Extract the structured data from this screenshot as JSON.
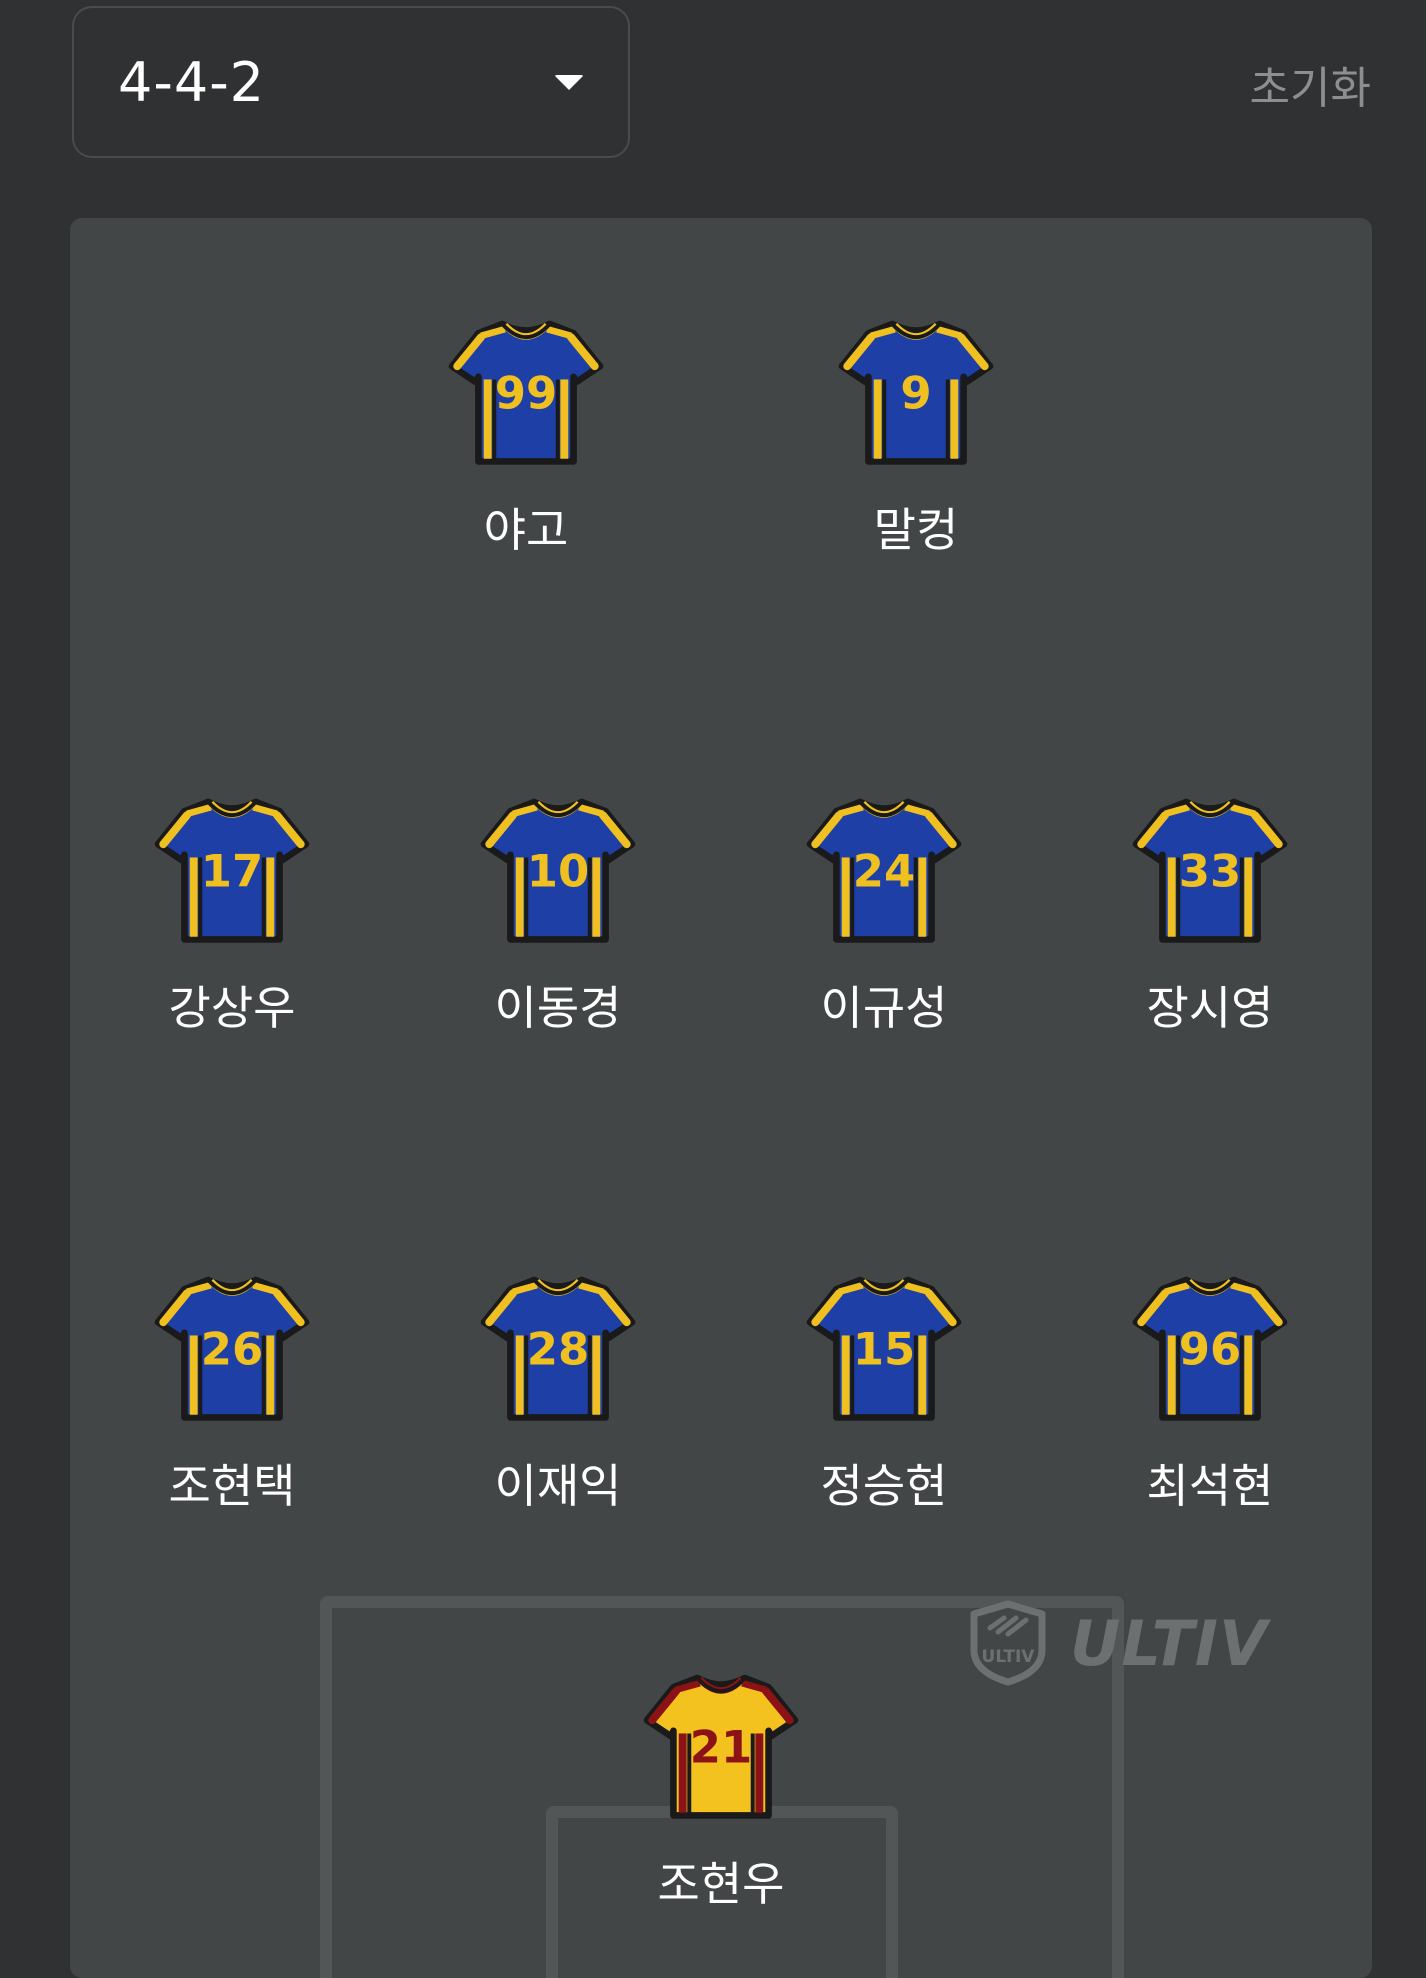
{
  "formation": {
    "selected": "4-4-2"
  },
  "reset_label": "초기화",
  "colors": {
    "field_jersey": "#1d3fa6",
    "field_trim": "#f0c020",
    "field_number": "#f0c020",
    "keeper_jersey": "#f4c21f",
    "keeper_trim": "#8b1316",
    "keeper_number": "#8b1316"
  },
  "players": [
    {
      "number": "99",
      "name": "야고",
      "role": "field"
    },
    {
      "number": "9",
      "name": "말컹",
      "role": "field"
    },
    {
      "number": "17",
      "name": "강상우",
      "role": "field"
    },
    {
      "number": "10",
      "name": "이동경",
      "role": "field"
    },
    {
      "number": "24",
      "name": "이규성",
      "role": "field"
    },
    {
      "number": "33",
      "name": "장시영",
      "role": "field"
    },
    {
      "number": "26",
      "name": "조현택",
      "role": "field"
    },
    {
      "number": "28",
      "name": "이재익",
      "role": "field"
    },
    {
      "number": "15",
      "name": "정승현",
      "role": "field"
    },
    {
      "number": "96",
      "name": "최석현",
      "role": "field"
    },
    {
      "number": "21",
      "name": "조현우",
      "role": "keeper"
    }
  ],
  "watermark": {
    "brand": "ULTIV",
    "badge": "ULTIV",
    "icon": "ultiv-shield-icon"
  }
}
